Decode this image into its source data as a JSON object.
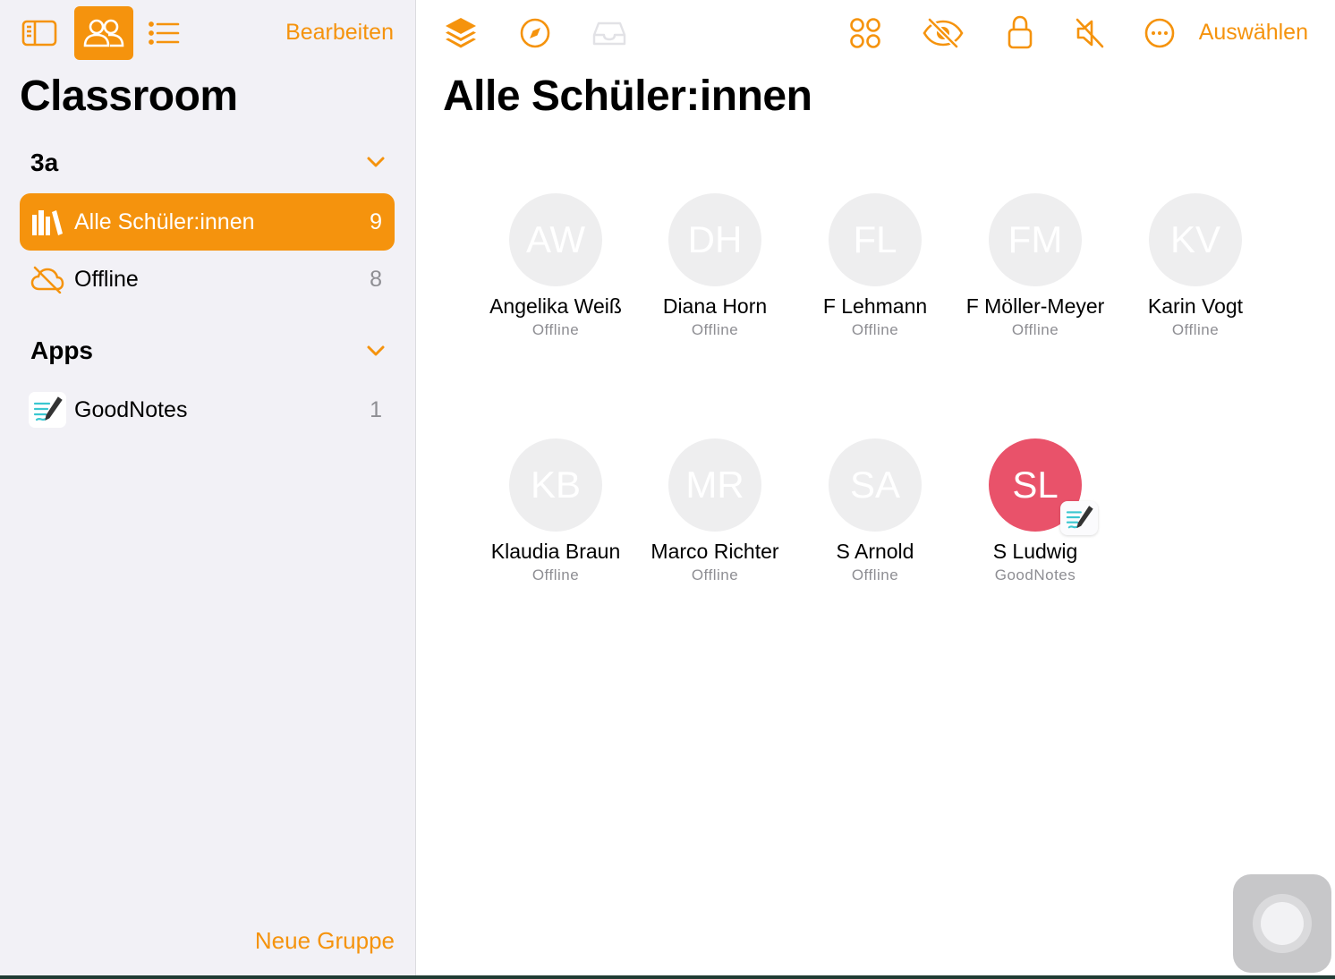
{
  "colors": {
    "accent": "#f5930d",
    "sidebar_bg": "#f2f1f6",
    "online_avatar": "#e9526a",
    "offline_avatar": "#eeeeef"
  },
  "sidebar": {
    "toolbar": {
      "icons": [
        "sidebar-toggle-icon",
        "people-icon",
        "list-icon"
      ],
      "edit_label": "Bearbeiten"
    },
    "app_title": "Classroom",
    "sections": [
      {
        "title": "3a",
        "items": [
          {
            "label": "Alle Schüler:innen",
            "count": "9",
            "icon": "library-icon",
            "selected": true
          },
          {
            "label": "Offline",
            "count": "8",
            "icon": "cloud-offline-icon",
            "selected": false
          }
        ]
      },
      {
        "title": "Apps",
        "items": [
          {
            "label": "GoodNotes",
            "count": "1",
            "icon": "goodnotes-icon",
            "selected": false
          }
        ]
      }
    ],
    "new_group_label": "Neue Gruppe"
  },
  "main": {
    "toolbar": {
      "left_icons": [
        "layers-icon",
        "compass-icon",
        "inbox-icon"
      ],
      "right_icons": [
        "grid-icon",
        "eye-slash-icon",
        "lock-icon",
        "mute-icon",
        "more-icon"
      ],
      "select_label": "Auswählen"
    },
    "title": "Alle Schüler:innen",
    "students": [
      {
        "initials": "AW",
        "name": "Angelika Weiß",
        "status": "Offline"
      },
      {
        "initials": "DH",
        "name": "Diana Horn",
        "status": "Offline"
      },
      {
        "initials": "FL",
        "name": "F Lehmann",
        "status": "Offline"
      },
      {
        "initials": "FM",
        "name": "F Möller-Meyer",
        "status": "Offline"
      },
      {
        "initials": "KV",
        "name": "Karin Vogt",
        "status": "Offline"
      },
      {
        "initials": "KB",
        "name": "Klaudia Braun",
        "status": "Offline"
      },
      {
        "initials": "MR",
        "name": "Marco Richter",
        "status": "Offline"
      },
      {
        "initials": "SA",
        "name": "S Arnold",
        "status": "Offline"
      },
      {
        "initials": "SL",
        "name": "S Ludwig",
        "status": "GoodNotes",
        "online": true,
        "app_badge": "goodnotes-icon"
      }
    ]
  }
}
